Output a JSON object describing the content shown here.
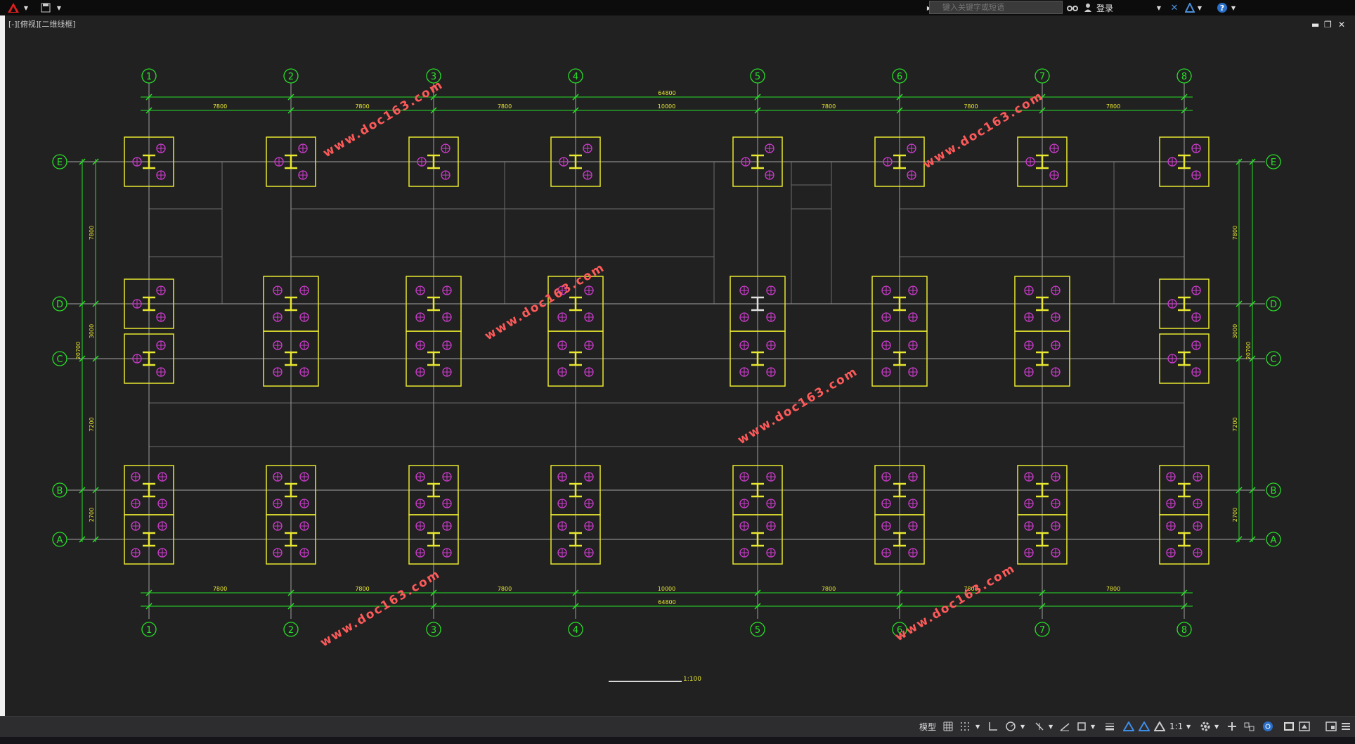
{
  "titlebar": {
    "app_icon": "autocad-logo-icon",
    "search_placeholder": "键入关键字或短语",
    "login_label": "登录"
  },
  "viewport": {
    "view_label": "[-][俯视][二维线框]"
  },
  "drawing": {
    "columns": [
      "1",
      "2",
      "3",
      "4",
      "5",
      "6",
      "7",
      "8"
    ],
    "rows": [
      "E",
      "D",
      "C",
      "B",
      "A"
    ],
    "column_spacings": [
      "7800",
      "7800",
      "7800",
      "10000",
      "7800",
      "7800",
      "7800"
    ],
    "overall_length": "64800",
    "row_spacings": [
      "7800",
      "3000",
      "7200",
      "2700"
    ],
    "overall_width": "20700",
    "watermark": "www.doc163.com",
    "scale_label": "1:100"
  },
  "statusbar": {
    "model_label": "模型",
    "scale_value": "1:1"
  }
}
